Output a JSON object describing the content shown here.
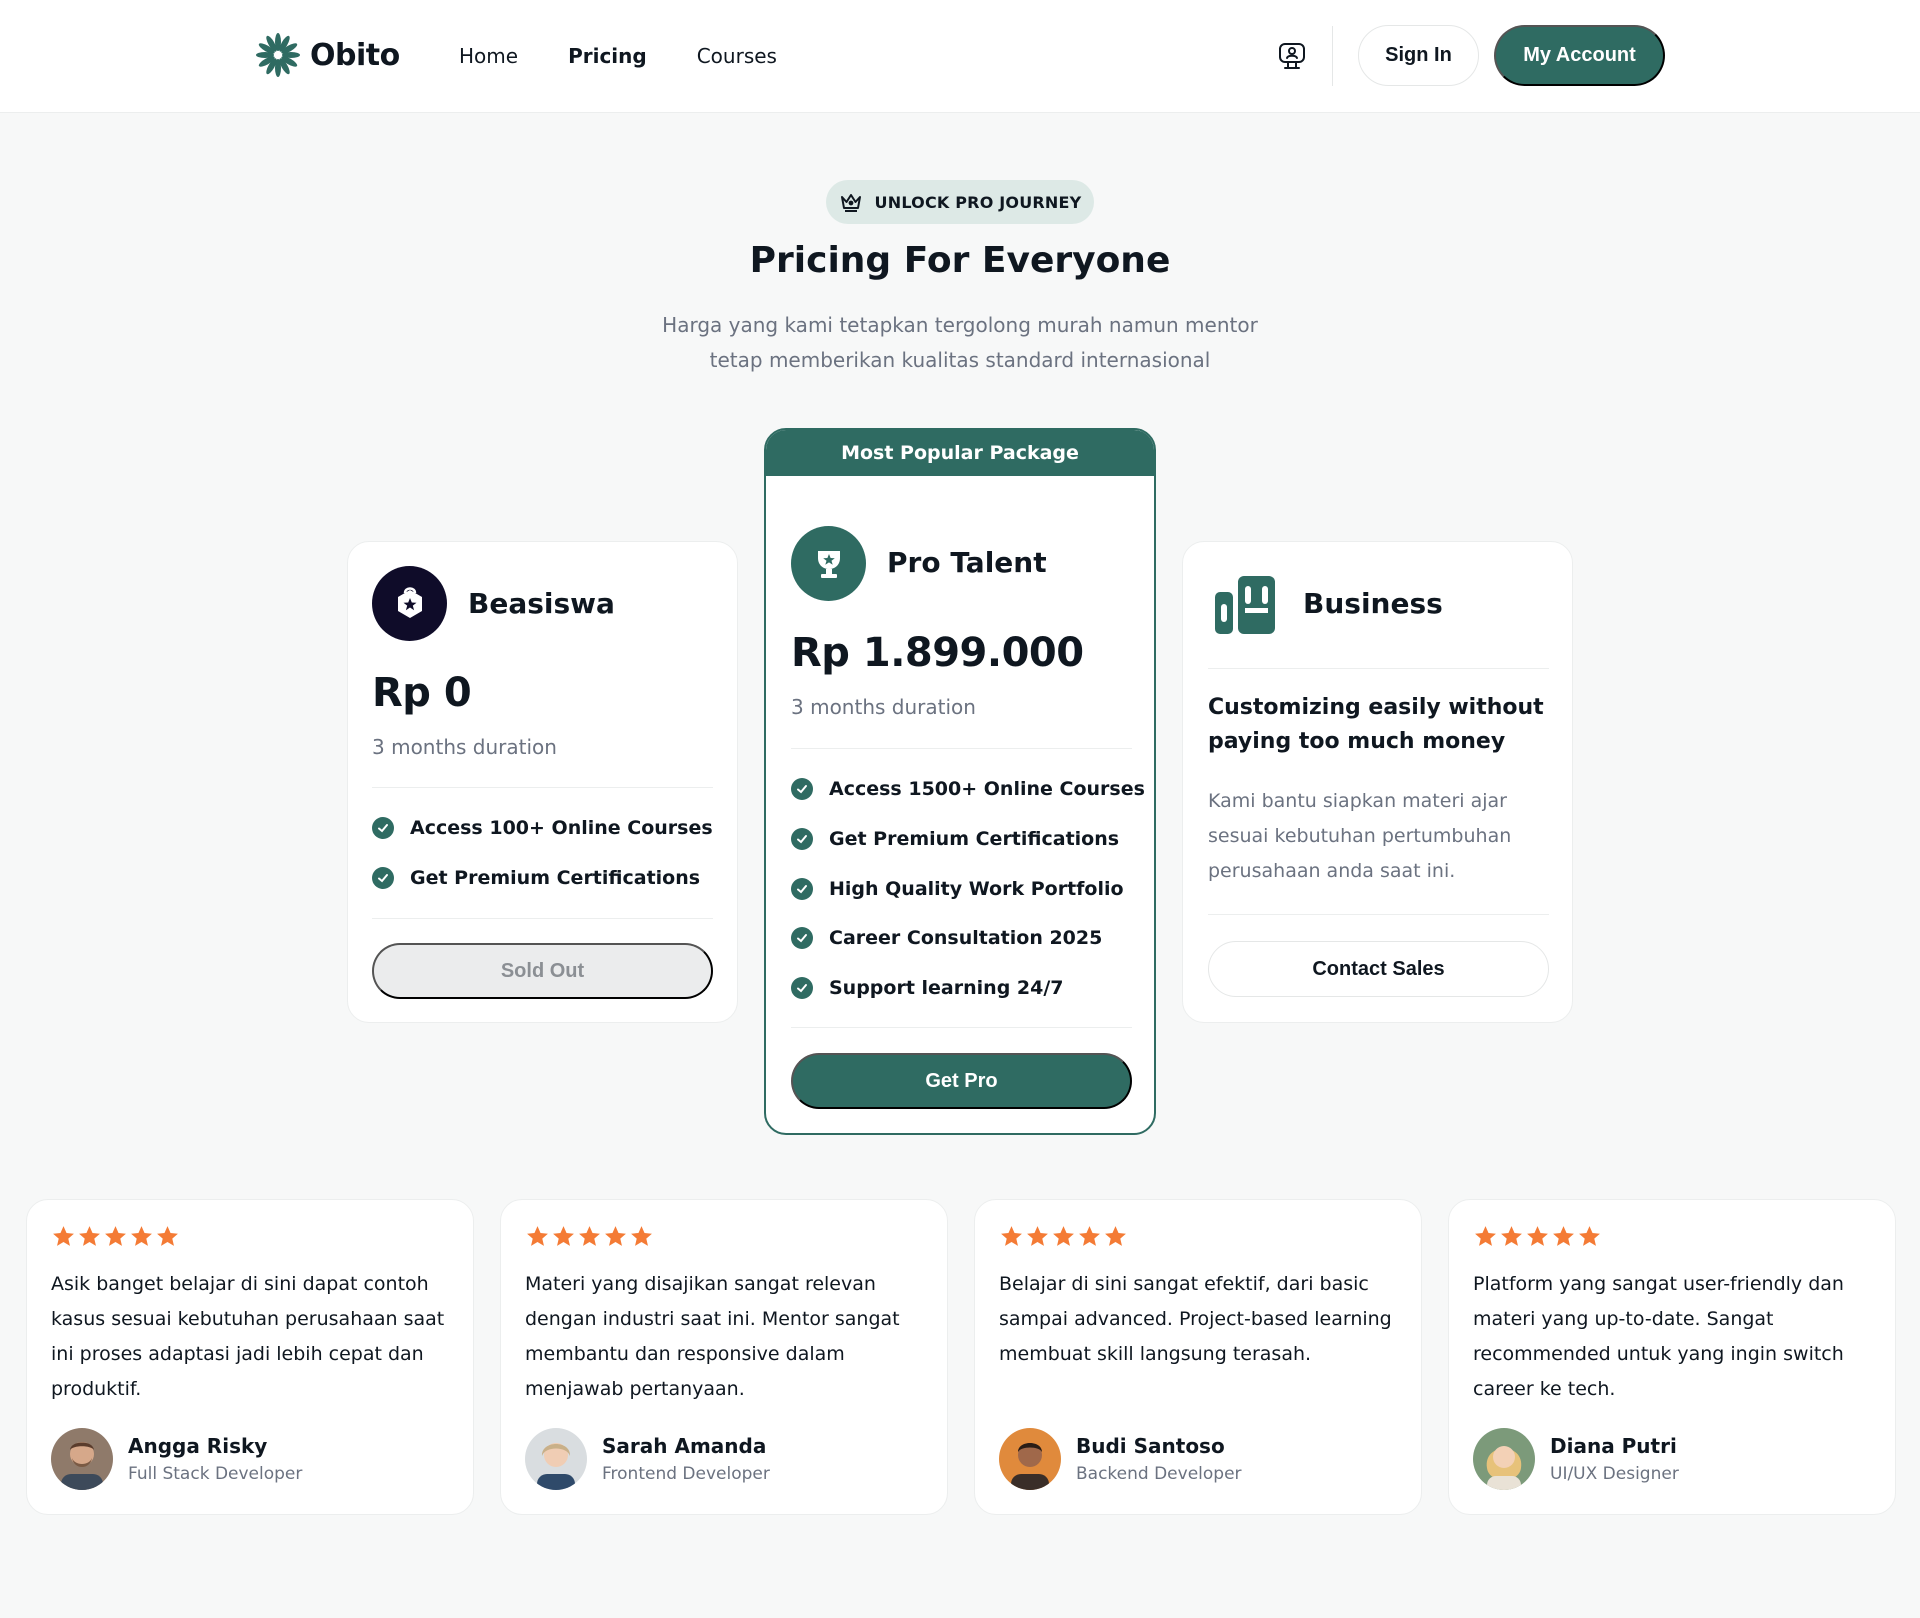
{
  "header": {
    "brand": "Obito",
    "nav": [
      {
        "label": "Home",
        "active": false
      },
      {
        "label": "Pricing",
        "active": true
      },
      {
        "label": "Courses",
        "active": false
      }
    ],
    "chat_icon": "chat-icon",
    "sign_in": "Sign In",
    "my_account": "My Account"
  },
  "hero": {
    "badge": "UNLOCK PRO JOURNEY",
    "badge_icon": "crown-icon",
    "title": "Pricing For Everyone",
    "subtitle_line1": "Harga yang kami tetapkan tergolong murah namun mentor",
    "subtitle_line2": "tetap memberikan kualitas standard internasional"
  },
  "plans": {
    "beasiswa": {
      "icon": "shield-star-icon",
      "name": "Beasiswa",
      "price": "Rp 0",
      "duration": "3 months duration",
      "features": [
        "Access 100+ Online Courses",
        "Get Premium Certifications"
      ],
      "button": "Sold Out"
    },
    "pro": {
      "banner": "Most Popular Package",
      "icon": "trophy-icon",
      "name": "Pro Talent",
      "price": "Rp 1.899.000",
      "duration": "3 months duration",
      "features": [
        "Access 1500+ Online Courses",
        "Get Premium Certifications",
        "High Quality Work Portfolio",
        "Career Consultation 2025",
        "Support learning 24/7"
      ],
      "button": "Get Pro"
    },
    "business": {
      "icon": "building-icon",
      "name": "Business",
      "headline_line1": "Customizing easily without",
      "headline_line2": "paying too much money",
      "desc_line1": "Kami bantu siapkan materi ajar",
      "desc_line2": "sesuai kebutuhan pertumbuhan",
      "desc_line3": "perusahaan anda saat ini.",
      "button": "Contact Sales"
    }
  },
  "testimonials": [
    {
      "rating": 5,
      "quote": "Asik banget belajar di sini dapat contoh kasus sesuai kebutuhan perusahaan saat ini proses adaptasi jadi lebih cepat dan produktif.",
      "name": "Angga Risky",
      "role": "Full Stack Developer"
    },
    {
      "rating": 5,
      "quote": "Materi yang disajikan sangat relevan dengan industri saat ini. Mentor sangat membantu dan responsive dalam menjawab pertanyaan.",
      "name": "Sarah Amanda",
      "role": "Frontend Developer"
    },
    {
      "rating": 5,
      "quote": "Belajar di sini sangat efektif, dari basic sampai advanced. Project-based learning membuat skill langsung terasah.",
      "name": "Budi Santoso",
      "role": "Backend Developer"
    },
    {
      "rating": 5,
      "quote": "Platform yang sangat user-friendly dan materi yang up-to-date. Sangat recommended untuk yang ingin switch career ke tech.",
      "name": "Diana Putri",
      "role": "UI/UX Designer"
    }
  ],
  "colors": {
    "primary": "#2f6b62",
    "dark_icon": "#0f0c29",
    "star": "#f47b35",
    "muted_text": "#6b7280",
    "background": "#f7f8f8"
  }
}
